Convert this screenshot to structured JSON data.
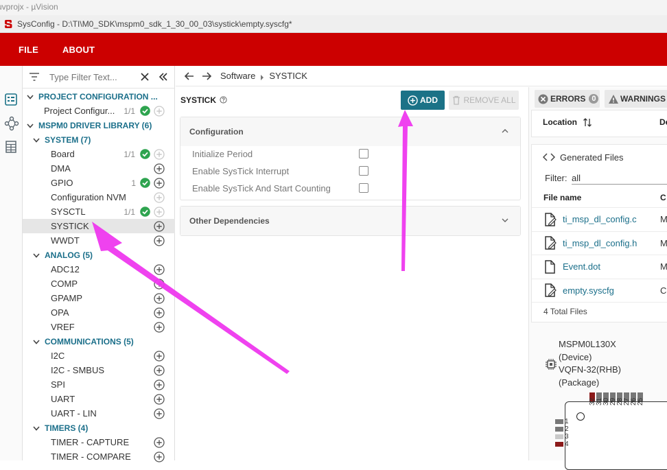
{
  "top_strip": {
    "text": "uvprojx - µVision"
  },
  "window": {
    "title": "SysConfig - D:\\TI\\M0_SDK\\mspm0_sdk_1_30_00_03\\systick\\empty.syscfg*"
  },
  "menu": {
    "file": "FILE",
    "about": "ABOUT"
  },
  "filter": {
    "placeholder": "Type Filter Text..."
  },
  "tree": {
    "project_config": {
      "label": "PROJECT CONFIGURATION ...",
      "child": "Project Configur...",
      "child_count": "1/1"
    },
    "driver_lib": {
      "label": "MSPM0 DRIVER LIBRARY (6)"
    },
    "system": {
      "label": "SYSTEM (7)",
      "items": [
        {
          "label": "Board",
          "count": "1/1"
        },
        {
          "label": "DMA",
          "count": ""
        },
        {
          "label": "GPIO",
          "count": "1"
        },
        {
          "label": "Configuration NVM",
          "count": ""
        },
        {
          "label": "SYSCTL",
          "count": "1/1"
        },
        {
          "label": "SYSTICK",
          "count": ""
        },
        {
          "label": "WWDT",
          "count": ""
        }
      ]
    },
    "analog": {
      "label": "ANALOG (5)",
      "items": [
        "ADC12",
        "COMP",
        "GPAMP",
        "OPA",
        "VREF"
      ]
    },
    "communications": {
      "label": "COMMUNICATIONS (5)",
      "items": [
        "I2C",
        "I2C - SMBUS",
        "SPI",
        "UART",
        "UART - LIN"
      ]
    },
    "timers": {
      "label": "TIMERS (4)",
      "items": [
        "TIMER - CAPTURE",
        "TIMER - COMPARE"
      ]
    }
  },
  "breadcrumb": {
    "root": "Software",
    "current": "SYSTICK"
  },
  "module": {
    "title": "SYSTICK",
    "add_label": "ADD",
    "remove_all_label": "REMOVE ALL",
    "configuration": {
      "label": "Configuration",
      "options": [
        "Initialize Period",
        "Enable SysTick Interrupt",
        "Enable SysTick And Start Counting"
      ]
    },
    "other_dependencies": {
      "label": "Other Dependencies"
    }
  },
  "right": {
    "errors_label": "ERRORS",
    "errors_count": "0",
    "warnings_label": "WARNINGS",
    "location_label": "Location",
    "de_label": "De",
    "generated_files": "Generated Files",
    "filter_label": "Filter:",
    "filter_value": "all",
    "file_name_col": "File name",
    "c_col": "C",
    "files": [
      {
        "name": "ti_msp_dl_config.c",
        "col": "M"
      },
      {
        "name": "ti_msp_dl_config.h",
        "col": "M"
      },
      {
        "name": "Event.dot",
        "col": "M"
      },
      {
        "name": "empty.syscfg",
        "col": "C"
      }
    ],
    "total_files": "4 Total Files",
    "device": {
      "name": "MSPM0L130X",
      "device_tag": "(Device)",
      "package": "VQFN-32(RHB)",
      "package_tag": "(Package)"
    },
    "top_pins": [
      "32",
      "31",
      "30",
      "29",
      "28",
      "27",
      "26",
      "25"
    ],
    "left_pins": [
      "1",
      "2",
      "3",
      "4"
    ]
  },
  "colors": {
    "brand_red": "#cc0000",
    "teal": "#1b7287",
    "green_check": "#2ea44f",
    "arrow": "#ee38ee"
  }
}
